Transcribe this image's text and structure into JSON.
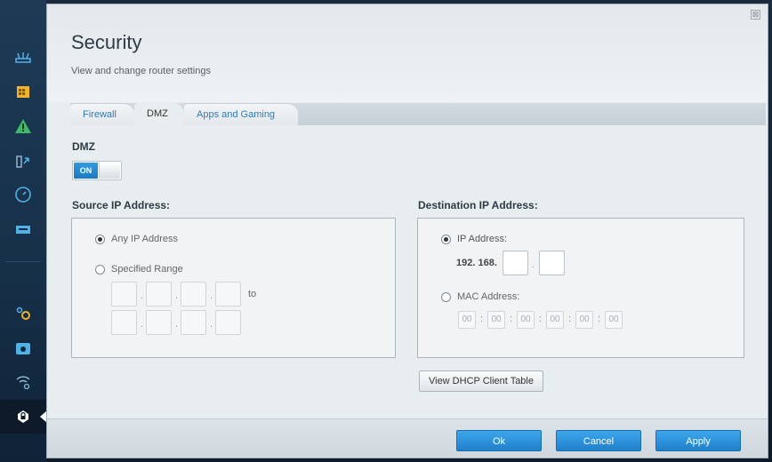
{
  "sidebar": {
    "items": [
      {
        "icon": "router-icon",
        "active": false
      },
      {
        "icon": "calendar-icon",
        "active": false
      },
      {
        "icon": "warning-icon",
        "active": false
      },
      {
        "icon": "devices-icon",
        "active": false
      },
      {
        "icon": "speed-icon",
        "active": false
      },
      {
        "icon": "usb-icon",
        "active": false
      },
      {
        "icon": "settings-icon",
        "active": false
      },
      {
        "icon": "toolkit-icon",
        "active": false
      },
      {
        "icon": "wifi-icon",
        "active": false
      },
      {
        "icon": "lock-icon",
        "active": true
      }
    ]
  },
  "header": {
    "title": "Security",
    "subtitle": "View and change router settings",
    "close_glyph": "⊠"
  },
  "tabs": [
    {
      "label": "Firewall",
      "active": false
    },
    {
      "label": "DMZ",
      "active": true
    },
    {
      "label": "Apps and Gaming",
      "active": false
    }
  ],
  "dmz": {
    "label": "DMZ",
    "toggle_label": "ON",
    "enabled": true
  },
  "source": {
    "heading": "Source IP Address:",
    "any_label": "Any IP Address",
    "specified_label": "Specified Range",
    "selected": "any",
    "to_label": "to",
    "dot": "."
  },
  "destination": {
    "heading": "Destination IP Address:",
    "ip_label": "IP Address:",
    "ip_prefix": "192. 168.",
    "mac_label": "MAC Address:",
    "selected": "ip",
    "mac_octets": [
      "00",
      "00",
      "00",
      "00",
      "00",
      "00"
    ],
    "colon": ":"
  },
  "buttons": {
    "dhcp_table": "View DHCP Client Table",
    "ok": "Ok",
    "cancel": "Cancel",
    "apply": "Apply"
  },
  "colors": {
    "accent": "#1f7fca",
    "tab_link": "#2e7bbd"
  }
}
